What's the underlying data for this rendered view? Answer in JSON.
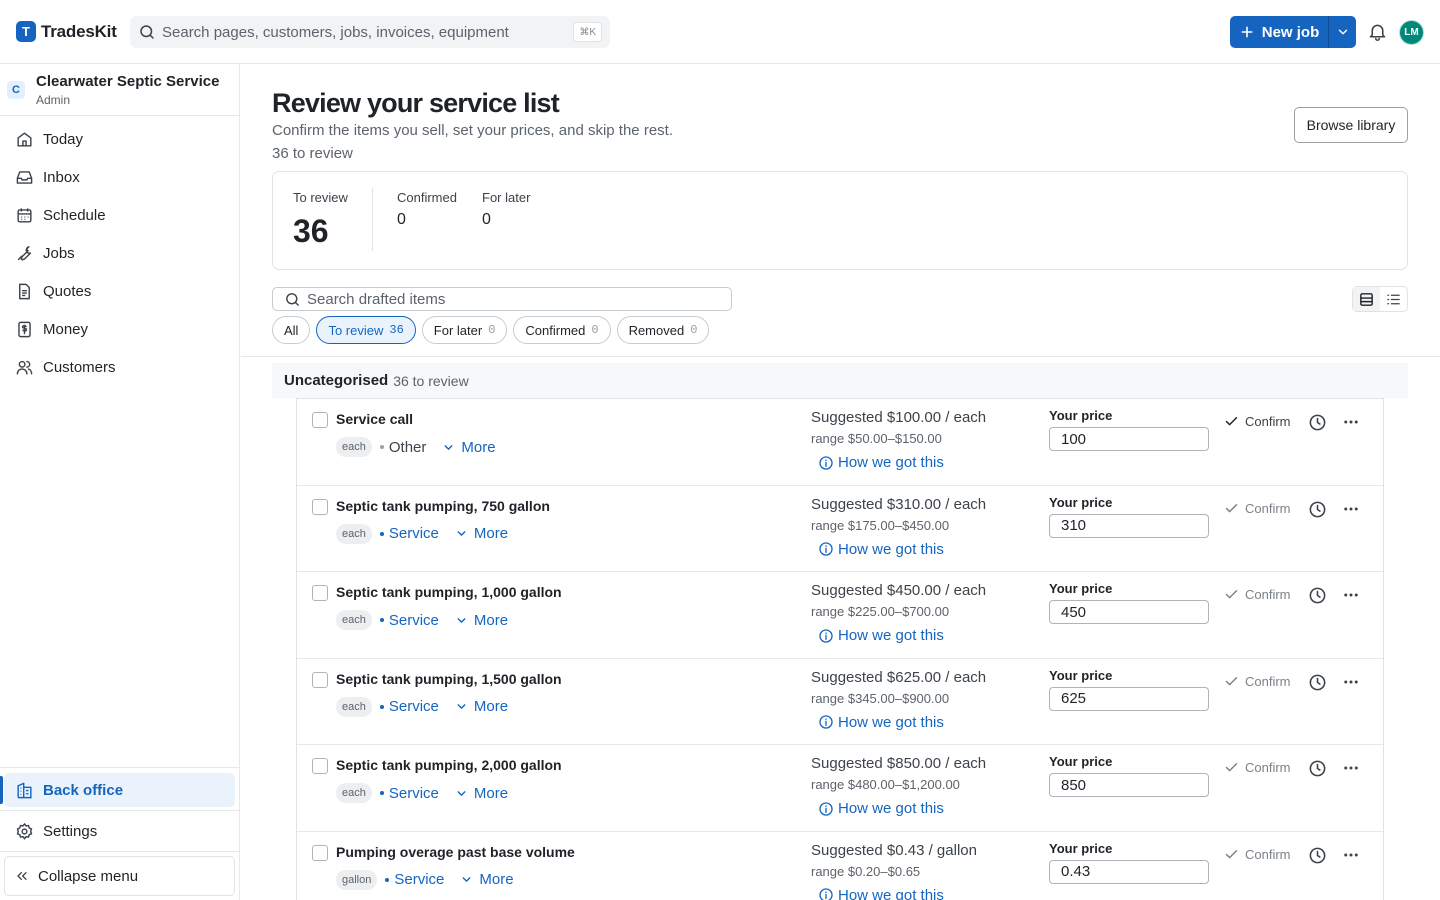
{
  "app": {
    "logo_letter": "T",
    "name": "TradesKit"
  },
  "search": {
    "placeholder": "Search pages, customers, jobs, invoices, equipment",
    "shortcut": "⌘K"
  },
  "header": {
    "new_job_label": "New job",
    "avatar_initials": "LM",
    "accent": "#1565c0"
  },
  "org": {
    "badge": "C",
    "name": "Clearwater Septic Service",
    "role": "Admin"
  },
  "nav": {
    "items": [
      {
        "label": "Today",
        "icon": "home-icon"
      },
      {
        "label": "Inbox",
        "icon": "inbox-icon"
      },
      {
        "label": "Schedule",
        "icon": "calendar-icon"
      },
      {
        "label": "Jobs",
        "icon": "wrench-icon"
      },
      {
        "label": "Quotes",
        "icon": "document-icon"
      },
      {
        "label": "Money",
        "icon": "dollar-icon"
      },
      {
        "label": "Customers",
        "icon": "users-icon"
      }
    ],
    "back_office": "Back office",
    "settings": "Settings",
    "collapse": "Collapse menu"
  },
  "page": {
    "title": "Review your service list",
    "subtitle": "Confirm the items you sell, set your prices, and skip the rest.",
    "count_text": "36 to review",
    "browse_button": "Browse library"
  },
  "stats": {
    "to_review": {
      "label": "To review",
      "value": "36"
    },
    "confirmed": {
      "label": "Confirmed",
      "value": "0"
    },
    "for_later": {
      "label": "For later",
      "value": "0"
    }
  },
  "list_search": {
    "placeholder": "Search drafted items"
  },
  "filters": [
    {
      "label": "All",
      "count": ""
    },
    {
      "label": "To review",
      "count": "36"
    },
    {
      "label": "For later",
      "count": "0"
    },
    {
      "label": "Confirmed",
      "count": "0"
    },
    {
      "label": "Removed",
      "count": "0"
    }
  ],
  "group": {
    "name": "Uncategorised",
    "count_text": "36 to review"
  },
  "row_labels": {
    "more": "More",
    "how": "How we got this",
    "your_price": "Your price",
    "confirm": "Confirm"
  },
  "items": [
    {
      "name": "Service call",
      "unit": "each",
      "category": "Other",
      "suggested": "Suggested $100.00 / each",
      "range": "range $50.00–$150.00",
      "price": "100"
    },
    {
      "name": "Septic tank pumping, 750 gallon",
      "unit": "each",
      "category": "Service",
      "suggested": "Suggested $310.00 / each",
      "range": "range $175.00–$450.00",
      "price": "310"
    },
    {
      "name": "Septic tank pumping, 1,000 gallon",
      "unit": "each",
      "category": "Service",
      "suggested": "Suggested $450.00 / each",
      "range": "range $225.00–$700.00",
      "price": "450"
    },
    {
      "name": "Septic tank pumping, 1,500 gallon",
      "unit": "each",
      "category": "Service",
      "suggested": "Suggested $625.00 / each",
      "range": "range $345.00–$900.00",
      "price": "625"
    },
    {
      "name": "Septic tank pumping, 2,000 gallon",
      "unit": "each",
      "category": "Service",
      "suggested": "Suggested $850.00 / each",
      "range": "range $480.00–$1,200.00",
      "price": "850"
    },
    {
      "name": "Pumping overage past base volume",
      "unit": "gallon",
      "category": "Service",
      "suggested": "Suggested $0.43 / gallon",
      "range": "range $0.20–$0.65",
      "price": "0.43"
    }
  ]
}
